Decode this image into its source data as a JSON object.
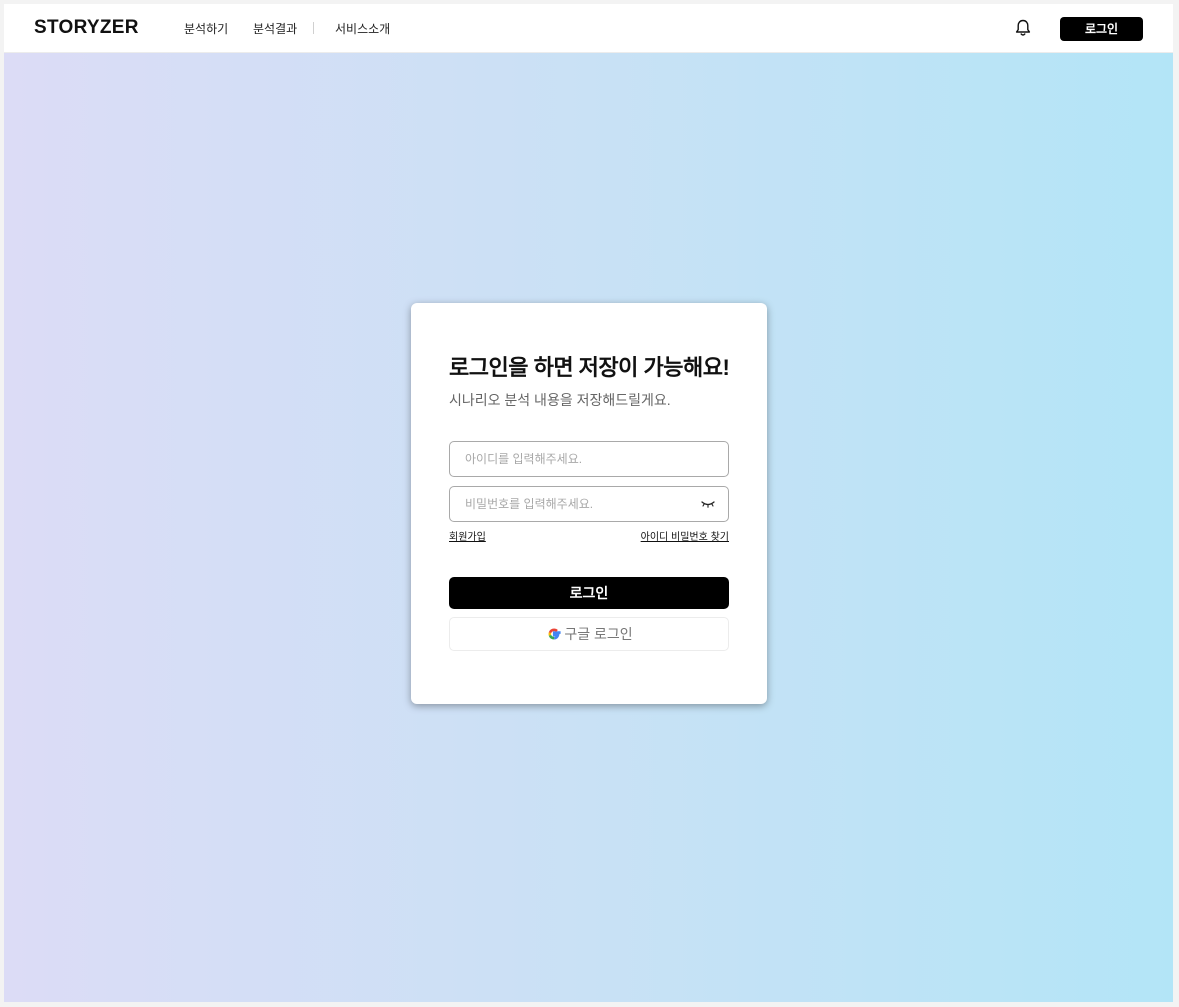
{
  "header": {
    "logo": "STORYZER",
    "nav": [
      {
        "label": "분석하기"
      },
      {
        "label": "분석결과"
      },
      {
        "label": "서비스소개"
      }
    ],
    "notification_icon": "bell-icon",
    "login_label": "로그인"
  },
  "login_card": {
    "title": "로그인을 하면 저장이 가능해요!",
    "subtitle": "시나리오 분석 내용을 저장해드릴게요.",
    "id_field": {
      "placeholder": "아이디를 입력해주세요.",
      "value": ""
    },
    "password_field": {
      "placeholder": "비밀번호를 입력해주세요.",
      "value": "",
      "toggle_icon": "eye-closed-icon"
    },
    "signup_link": "회원가입",
    "find_link": "아이디 비밀번호 찾기",
    "login_button": "로그인",
    "google_button": {
      "label": "구글 로그인",
      "icon": "google-icon"
    }
  },
  "colors": {
    "primary": "#000000",
    "gradient_start": "#dcdcf6",
    "gradient_end": "#b3e5f7"
  }
}
